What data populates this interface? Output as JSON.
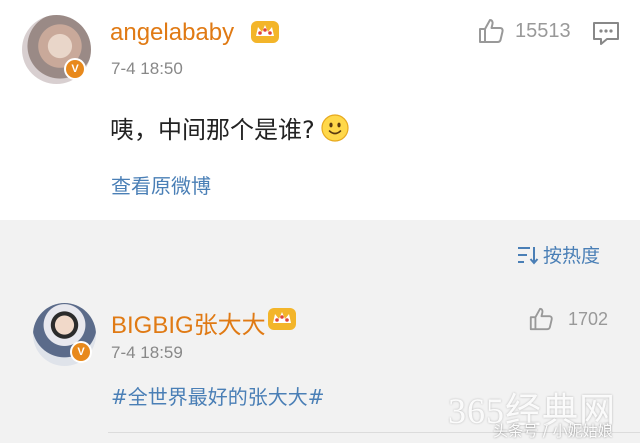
{
  "post": {
    "username": "angelababy",
    "timestamp": "7-4 18:50",
    "like_count": "15513",
    "comment_text": "咦，中间那个是谁?",
    "view_original_label": "查看原微博",
    "verified_badge": "V",
    "icons": [
      "avatar",
      "verified-badge-icon",
      "crown-icon",
      "thumbs-up-icon",
      "comment-icon",
      "smile-emoji-icon"
    ]
  },
  "sort": {
    "label": "按热度",
    "icon": "sort-icon"
  },
  "reply": {
    "username": "BIGBIG张大大",
    "timestamp": "7-4 18:59",
    "like_count": "1702",
    "text": "#全世界最好的张大大#",
    "verified_badge": "V"
  },
  "watermark": {
    "site": "365经典网",
    "source": "头条号 / 小妮姑娘"
  },
  "colors": {
    "username": "#e07a14",
    "link": "#4a7fb6",
    "badge": "#e8891c",
    "background": "#f2f2f2"
  }
}
